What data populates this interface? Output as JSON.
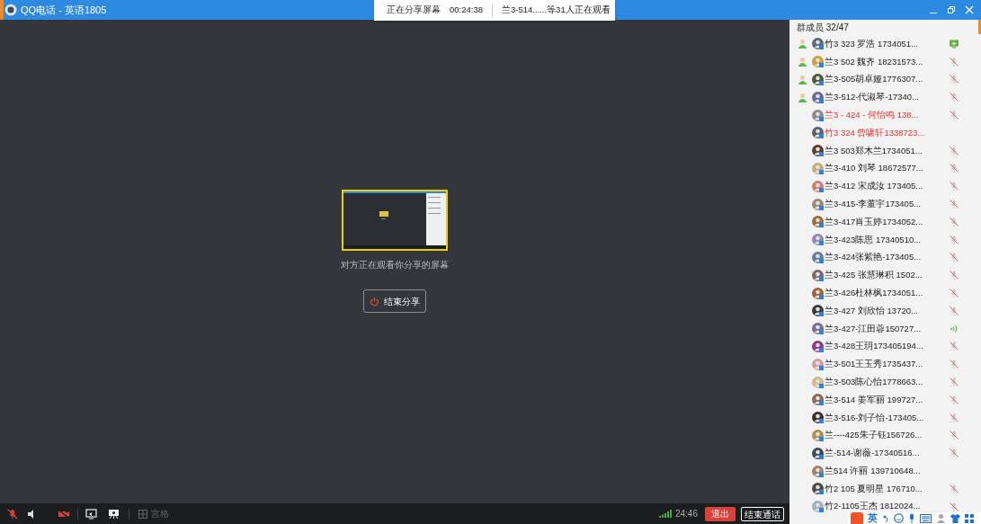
{
  "window": {
    "title": "QQ电话 - 英语1805"
  },
  "share_banner": {
    "status": "正在分享屏幕",
    "elapsed": "00:24:38",
    "viewers": "兰3-514......等31人正在观看"
  },
  "share_view": {
    "caption": "对方正在观看你分享的屏幕",
    "stop_button": "结束分享"
  },
  "toolbar": {
    "mic_muted": true,
    "camera_off": true,
    "grid_label": "宫格",
    "grid_disabled": true,
    "time": "24:46",
    "exit_button": "退出",
    "end_button": "结束通话"
  },
  "members": {
    "header": "群成员 32/47",
    "items": [
      {
        "name": "竹3 323  罗浩  1734051...",
        "admin": true,
        "highlighted": false,
        "kind": "screen"
      },
      {
        "name": "兰3 502 魏齐 18231573...",
        "admin": true,
        "highlighted": false,
        "kind": "muted"
      },
      {
        "name": "兰3-505胡卓娅1776307...",
        "admin": true,
        "highlighted": false,
        "kind": "muted"
      },
      {
        "name": "兰3-512-代淑琴-17340...",
        "admin": true,
        "highlighted": false,
        "kind": "muted"
      },
      {
        "name": "兰3 - 424 - 何怡鸣  138...",
        "admin": false,
        "highlighted": true,
        "kind": "muted"
      },
      {
        "name": "竹3 324 曾啸轩1338723...",
        "admin": false,
        "highlighted": true,
        "kind": "none"
      },
      {
        "name": "兰3 503郑木兰1734051...",
        "admin": false,
        "highlighted": false,
        "kind": "muted"
      },
      {
        "name": "兰3-410 刘琴 18672577...",
        "admin": false,
        "highlighted": false,
        "kind": "muted"
      },
      {
        "name": "兰3-412 宋成汝 173405...",
        "admin": false,
        "highlighted": false,
        "kind": "muted"
      },
      {
        "name": "兰3-415-李董宇173405...",
        "admin": false,
        "highlighted": false,
        "kind": "muted"
      },
      {
        "name": "兰3-417肖玉婷1734052...",
        "admin": false,
        "highlighted": false,
        "kind": "muted"
      },
      {
        "name": "兰3-423陈思 17340510...",
        "admin": false,
        "highlighted": false,
        "kind": "muted"
      },
      {
        "name": "兰3-424张紫艳-173405...",
        "admin": false,
        "highlighted": false,
        "kind": "muted"
      },
      {
        "name": "兰3-425 张慧琳积 1502...",
        "admin": false,
        "highlighted": false,
        "kind": "muted"
      },
      {
        "name": "兰3-426杜林枫1734051...",
        "admin": false,
        "highlighted": false,
        "kind": "muted"
      },
      {
        "name": "兰3-427  刘欣怡 13720...",
        "admin": false,
        "highlighted": false,
        "kind": "muted"
      },
      {
        "name": "兰3-427-江田蓉150727...",
        "admin": false,
        "highlighted": false,
        "kind": "speaking"
      },
      {
        "name": "兰3-428王玥173405194...",
        "admin": false,
        "highlighted": false,
        "kind": "muted"
      },
      {
        "name": "兰3-501王玉秀1735437...",
        "admin": false,
        "highlighted": false,
        "kind": "muted"
      },
      {
        "name": "兰3-503陈心怡1778663...",
        "admin": false,
        "highlighted": false,
        "kind": "muted"
      },
      {
        "name": "兰3-514 姜军丽 199727...",
        "admin": false,
        "highlighted": false,
        "kind": "muted"
      },
      {
        "name": "兰3-516-刘子怡-173405...",
        "admin": false,
        "highlighted": false,
        "kind": "muted"
      },
      {
        "name": "兰----425朱子钰156726...",
        "admin": false,
        "highlighted": false,
        "kind": "muted"
      },
      {
        "name": "兰-514-谢薇-17340516...",
        "admin": false,
        "highlighted": false,
        "kind": "muted"
      },
      {
        "name": "兰514 许丽 139710648...",
        "admin": false,
        "highlighted": false,
        "kind": "none"
      },
      {
        "name": "竹2 105 夏明星 176710...",
        "admin": false,
        "highlighted": false,
        "kind": "muted"
      },
      {
        "name": "竹2-1105王杰 1812024...",
        "admin": false,
        "highlighted": false,
        "kind": "muted"
      }
    ]
  },
  "ime": {
    "mode": "英"
  }
}
